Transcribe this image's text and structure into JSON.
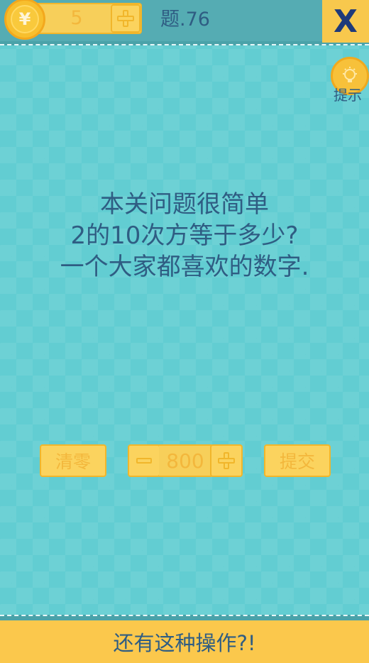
{
  "header": {
    "coins": "5",
    "coin_symbol": "¥",
    "level_label": "题.76",
    "close_label": "X"
  },
  "hint": {
    "label": "提示"
  },
  "question": {
    "lines": [
      "本关问题很简单",
      "2的10次方等于多少?",
      "一个大家都喜欢的数字."
    ]
  },
  "controls": {
    "clear_label": "清零",
    "value": "800",
    "submit_label": "提交"
  },
  "footer": {
    "label": "还有这种操作?!"
  },
  "colors": {
    "background": "#62cdd2",
    "accent_yellow": "#fbd35e",
    "text_navy": "#2f5d83"
  },
  "icons": [
    "coin-icon",
    "plus-icon",
    "close-icon",
    "lightbulb-icon",
    "minus-icon"
  ]
}
